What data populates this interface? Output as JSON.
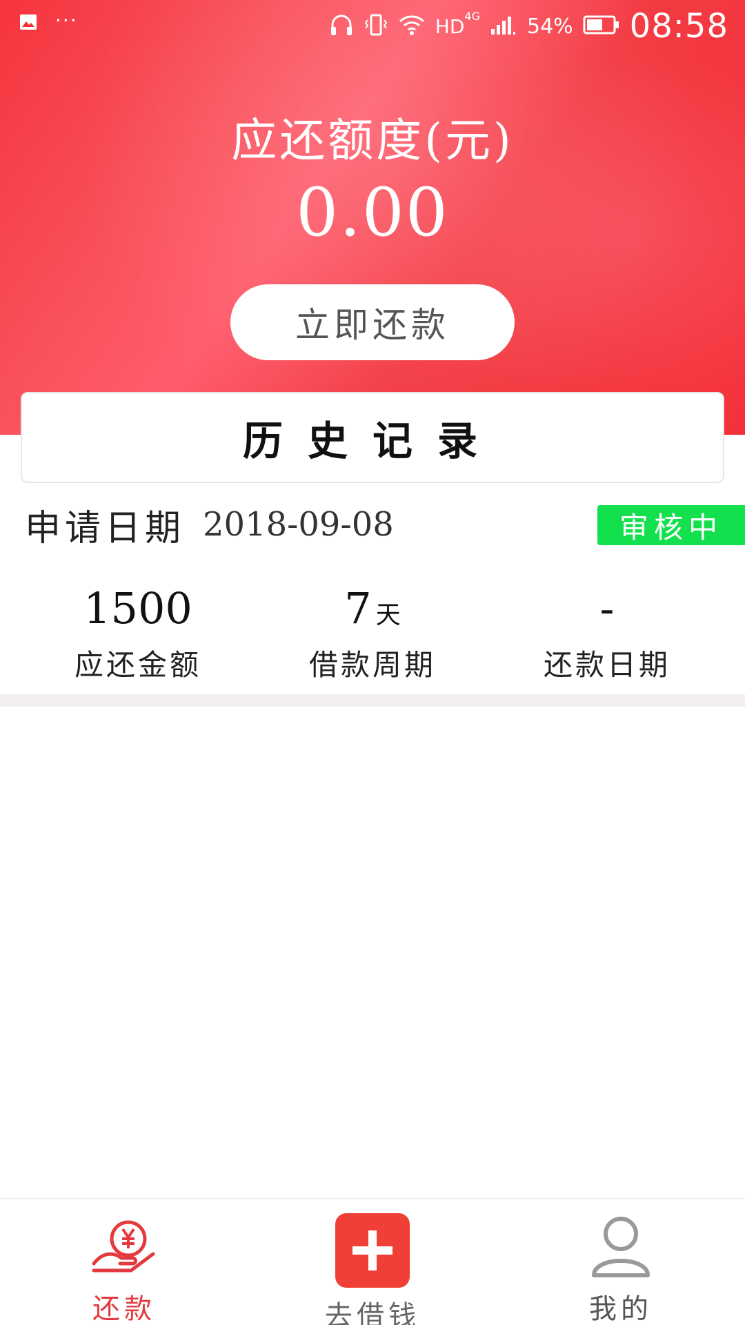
{
  "status_bar": {
    "network": "HD",
    "network_type": "4G",
    "battery": "54%",
    "time": "08:58"
  },
  "summary": {
    "label": "应还额度(元)",
    "amount": "0.00",
    "button": "立即还款"
  },
  "history": {
    "title": "历史记录"
  },
  "record": {
    "date_label": "申请日期",
    "date": "2018-09-08",
    "status": "审核中",
    "amount_value": "1500",
    "amount_label": "应还金额",
    "period_value": "7",
    "period_unit": "天",
    "period_label": "借款周期",
    "repay_date_value": "-",
    "repay_date_label": "还款日期"
  },
  "nav": {
    "repay": "还款",
    "borrow": "去借钱",
    "mine": "我的"
  },
  "colors": {
    "header_red": "#f4323b",
    "status_green": "#13e04d",
    "active_red": "#e23a3e",
    "plus_red": "#ef3f36"
  },
  "icons": [
    "gallery-icon",
    "headphones-icon",
    "vibrate-icon",
    "wifi-icon",
    "signal-icon",
    "battery-icon",
    "yen-hand-icon",
    "plus-icon",
    "user-icon"
  ]
}
